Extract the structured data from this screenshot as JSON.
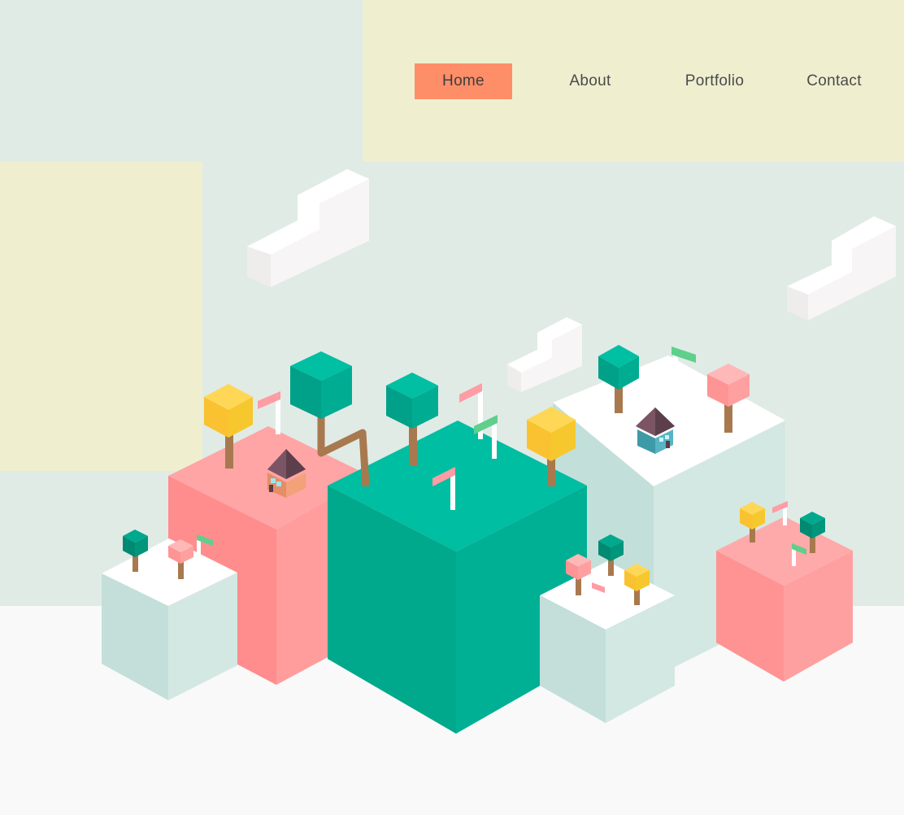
{
  "nav": {
    "items": [
      {
        "label": "Home",
        "active": true
      },
      {
        "label": "About",
        "active": false
      },
      {
        "label": "Portfolio",
        "active": false
      },
      {
        "label": "Contact",
        "active": false
      }
    ]
  },
  "illustration": {
    "subject": "isometric-blocks-with-trees-houses-and-flags",
    "palette": {
      "background": "#e0ebe6",
      "panel": "#efefd0",
      "ground": "#f9f9f9",
      "accent": "#fd8e68",
      "teal": "#00b99c",
      "pink": "#ff9c9c",
      "mint": "#c6e0db",
      "yellow": "#fcd03d",
      "brown": "#a8794e"
    }
  }
}
